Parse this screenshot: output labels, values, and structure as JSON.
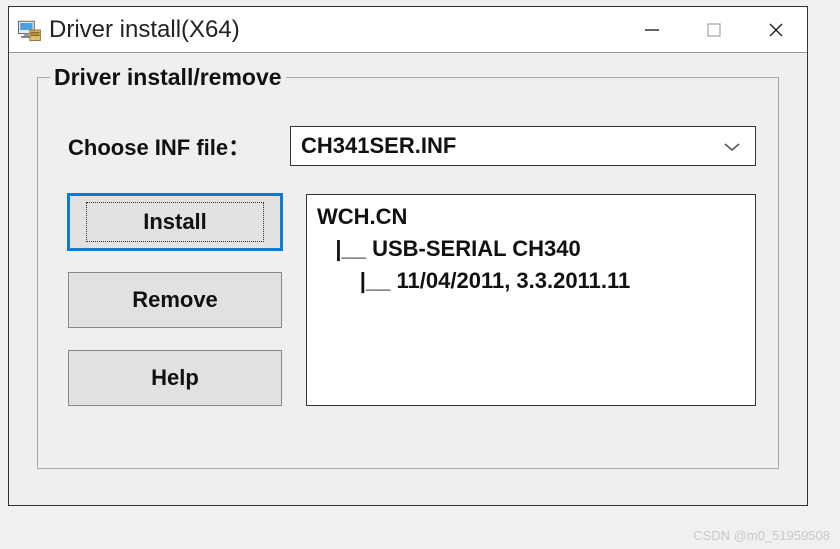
{
  "window": {
    "title": "Driver install(X64)"
  },
  "group": {
    "legend": "Driver install/remove",
    "inf_label": "Choose INF file：",
    "inf_value": "CH341SER.INF"
  },
  "buttons": {
    "install": "Install",
    "remove": "Remove",
    "help": "Help"
  },
  "info": {
    "line1": "WCH.CN",
    "line2": "   |__ USB-SERIAL CH340",
    "line3": "       |__ 11/04/2011, 3.3.2011.11"
  },
  "watermark": "CSDN @m0_51959508"
}
